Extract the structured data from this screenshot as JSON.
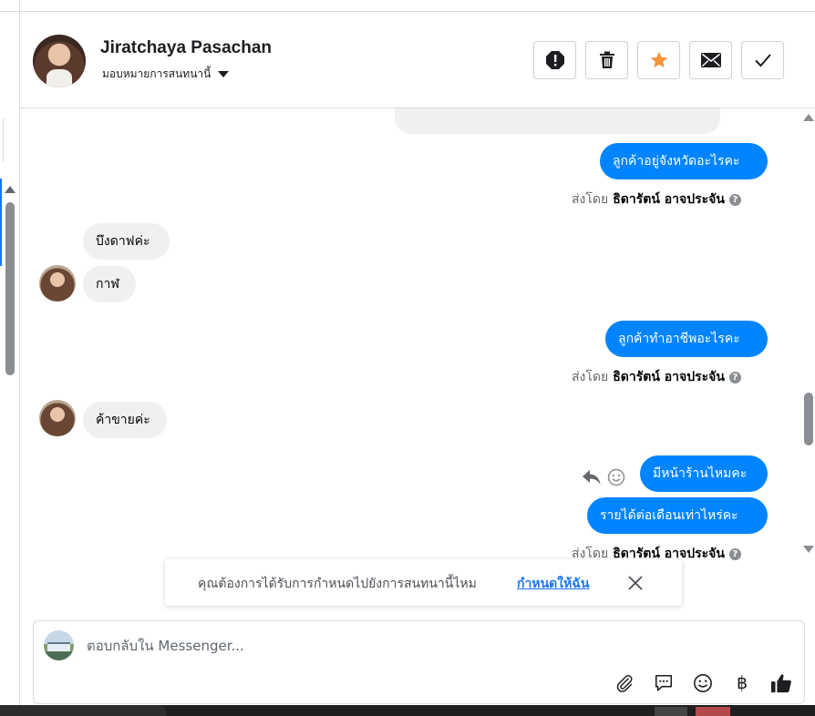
{
  "header": {
    "contact_name": "Jiratchaya Pasachan",
    "assign_label": "มอบหมายการสนทนานี้",
    "actions": [
      {
        "name": "spam-icon"
      },
      {
        "name": "trash-icon"
      },
      {
        "name": "star-icon",
        "color": "#f7923b"
      },
      {
        "name": "envelope-icon"
      },
      {
        "name": "check-icon"
      }
    ]
  },
  "messages": {
    "out_1": "ลูกค้าอยู่จังหวัดอะไรคะ",
    "in_1": "บึงดาฟค่ะ",
    "in_2": "กาฬ",
    "out_2": "ลูกค้าทำอาชีพอะไรคะ",
    "in_3": "ค้าขายค่ะ",
    "out_3": "มีหน้าร้านไหมคะ",
    "out_4": "รายได้ต่อเดือนเท่าไหร่คะ"
  },
  "sent_by": {
    "prefix": "ส่งโดย",
    "agent": "ธิดารัตน์ อาจประจัน",
    "help": "?"
  },
  "toast": {
    "text": "คุณต้องการได้รับการกำหนดไปยังการสนทนานี้ไหม",
    "link": "กำหนดให้ฉัน"
  },
  "composer": {
    "placeholder": "ตอบกลับใน Messenger...",
    "tools": [
      "attachment-icon",
      "saved-reply-icon",
      "emoji-icon",
      "baht-icon",
      "thumbs-up-icon"
    ],
    "baht": "฿"
  },
  "colors": {
    "outgoing_bubble": "#0084ff",
    "incoming_bubble": "#f0f0f0",
    "link": "#1877f2",
    "star": "#f7923b"
  }
}
